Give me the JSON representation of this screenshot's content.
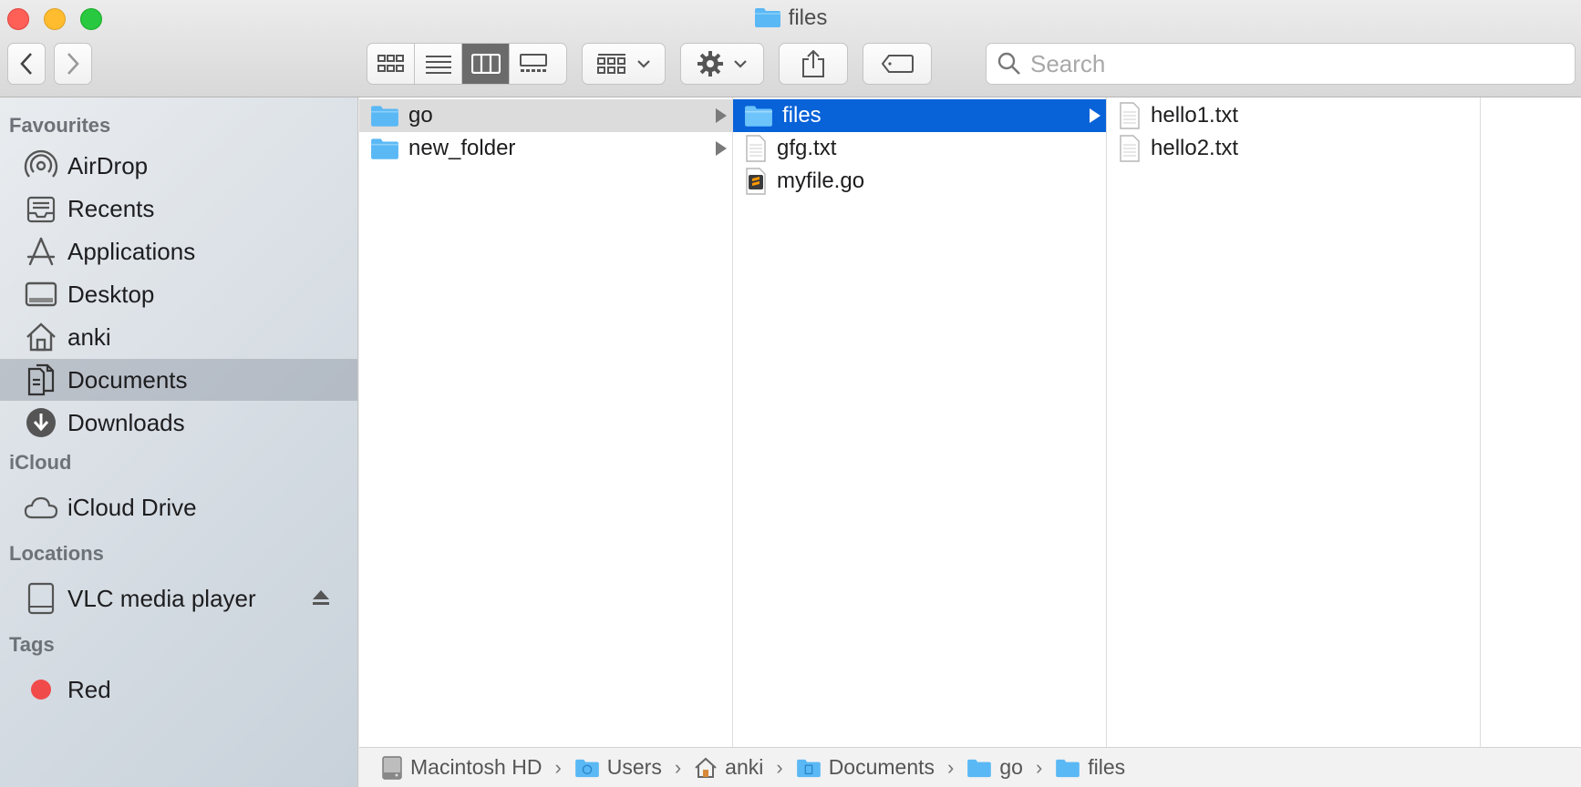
{
  "window": {
    "title": "files"
  },
  "toolbar": {
    "back_icon": "chevron-left-icon",
    "forward_icon": "chevron-right-icon",
    "view_modes": [
      "icon-view",
      "list-view",
      "column-view",
      "gallery-view"
    ],
    "active_view": "column-view",
    "search_placeholder": "Search"
  },
  "sidebar": {
    "favourites_heading": "Favourites",
    "favourites": [
      {
        "label": "AirDrop",
        "icon": "airdrop-icon"
      },
      {
        "label": "Recents",
        "icon": "recents-icon"
      },
      {
        "label": "Applications",
        "icon": "applications-icon"
      },
      {
        "label": "Desktop",
        "icon": "desktop-icon"
      },
      {
        "label": "anki",
        "icon": "home-icon"
      },
      {
        "label": "Documents",
        "icon": "documents-icon",
        "selected": true
      },
      {
        "label": "Downloads",
        "icon": "downloads-icon"
      }
    ],
    "icloud_heading": "iCloud",
    "icloud": [
      {
        "label": "iCloud Drive",
        "icon": "cloud-icon"
      }
    ],
    "locations_heading": "Locations",
    "locations": [
      {
        "label": "VLC media player",
        "icon": "disk-icon",
        "ejectable": true
      }
    ],
    "tags_heading": "Tags",
    "tags": [
      {
        "label": "Red",
        "color": "#f04a4a"
      }
    ]
  },
  "columns": [
    {
      "items": [
        {
          "label": "go",
          "type": "folder",
          "selected": "inactive"
        },
        {
          "label": "new_folder",
          "type": "folder"
        }
      ]
    },
    {
      "items": [
        {
          "label": "files",
          "type": "folder",
          "selected": "active"
        },
        {
          "label": "gfg.txt",
          "type": "text"
        },
        {
          "label": "myfile.go",
          "type": "sublime"
        }
      ]
    },
    {
      "items": [
        {
          "label": "hello1.txt",
          "type": "text"
        },
        {
          "label": "hello2.txt",
          "type": "text"
        }
      ]
    }
  ],
  "pathbar": [
    {
      "label": "Macintosh HD",
      "icon": "hard-drive-icon"
    },
    {
      "label": "Users",
      "icon": "users-folder-icon"
    },
    {
      "label": "anki",
      "icon": "home-icon"
    },
    {
      "label": "Documents",
      "icon": "documents-folder-icon"
    },
    {
      "label": "go",
      "icon": "folder-icon"
    },
    {
      "label": "files",
      "icon": "folder-icon"
    }
  ],
  "colors": {
    "selection": "#0862d8",
    "folder": "#5ab8f5"
  }
}
